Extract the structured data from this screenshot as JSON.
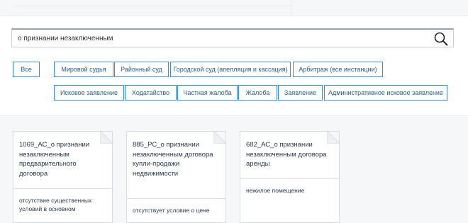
{
  "search": {
    "value": "о признании незаключенным"
  },
  "filters": {
    "row1": [
      "Все",
      "Мировой судья",
      "Районный суд",
      "Городской суд (апелляция и кассация)",
      "Арбитраж (все инстанции)"
    ],
    "row2": [
      "Исковое заявление",
      "Ходатайство",
      "Частная жалоба",
      "Жалоба",
      "Заявление",
      "Административное исковое заявление"
    ]
  },
  "cards": [
    {
      "title": "1069_АС_о признании незаключенным предварительного договора",
      "desc": "отсутствие существенных условий в основном"
    },
    {
      "title": "885_РС_о признании незаключенным договора купли-продажи недвижимости",
      "desc": "отсутствует условие о цене"
    },
    {
      "title": "682_АС_о признании незаключенным договора аренды",
      "desc": "нежилое помещение"
    }
  ],
  "colors": {
    "accent": "#3a8fd0",
    "chip_text": "#2c5c8a",
    "text": "#2a3a4a"
  }
}
